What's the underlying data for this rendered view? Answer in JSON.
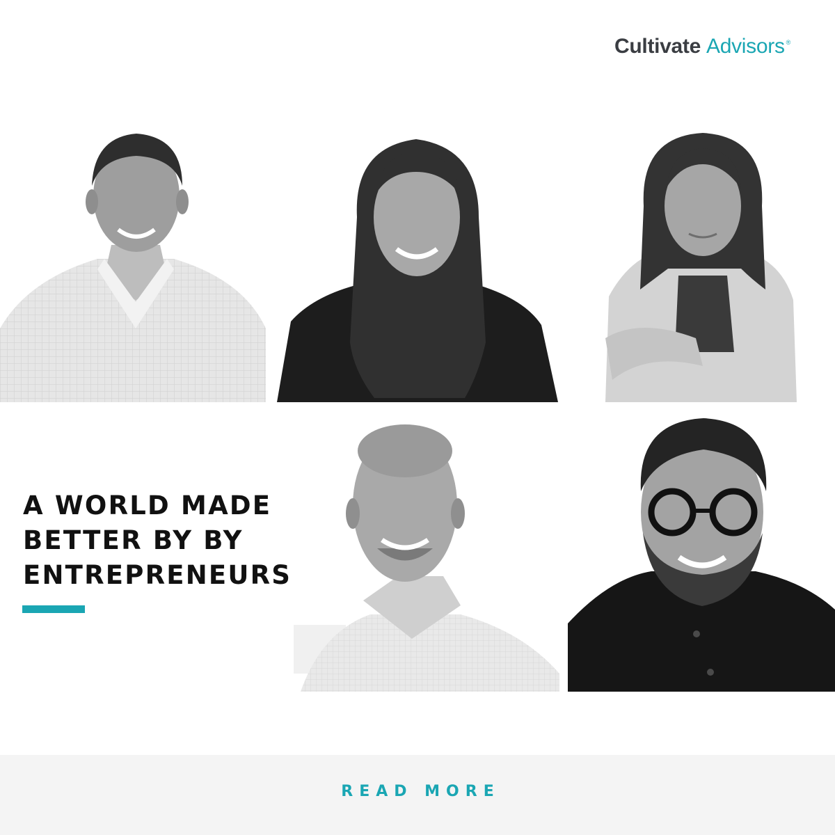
{
  "brand": {
    "name_part1": "Cultivate",
    "name_part2": "Advisors",
    "reg_mark": "®",
    "accent_color": "#1aa6b3",
    "text_color": "#3a3d42"
  },
  "headline": {
    "line1": "A WORLD MADE",
    "line2": "BETTER BY BY",
    "line3": "ENTREPRENEURS"
  },
  "photos": [
    {
      "subject": "man in checked button-down shirt, smiling",
      "style": "black-and-white"
    },
    {
      "subject": "woman with long dark hair in black top, smiling",
      "style": "black-and-white"
    },
    {
      "subject": "woman with shoulder-length hair in cardigan, arms crossed",
      "style": "black-and-white"
    },
    {
      "subject": "bald man in light collared shirt, smiling",
      "style": "black-and-white"
    },
    {
      "subject": "man with glasses and beard in dark shirt, smiling",
      "style": "black-and-white"
    }
  ],
  "cta": {
    "label": "READ MORE"
  },
  "colors": {
    "accent": "#1aa6b3",
    "footer_bg": "#f4f4f4"
  }
}
